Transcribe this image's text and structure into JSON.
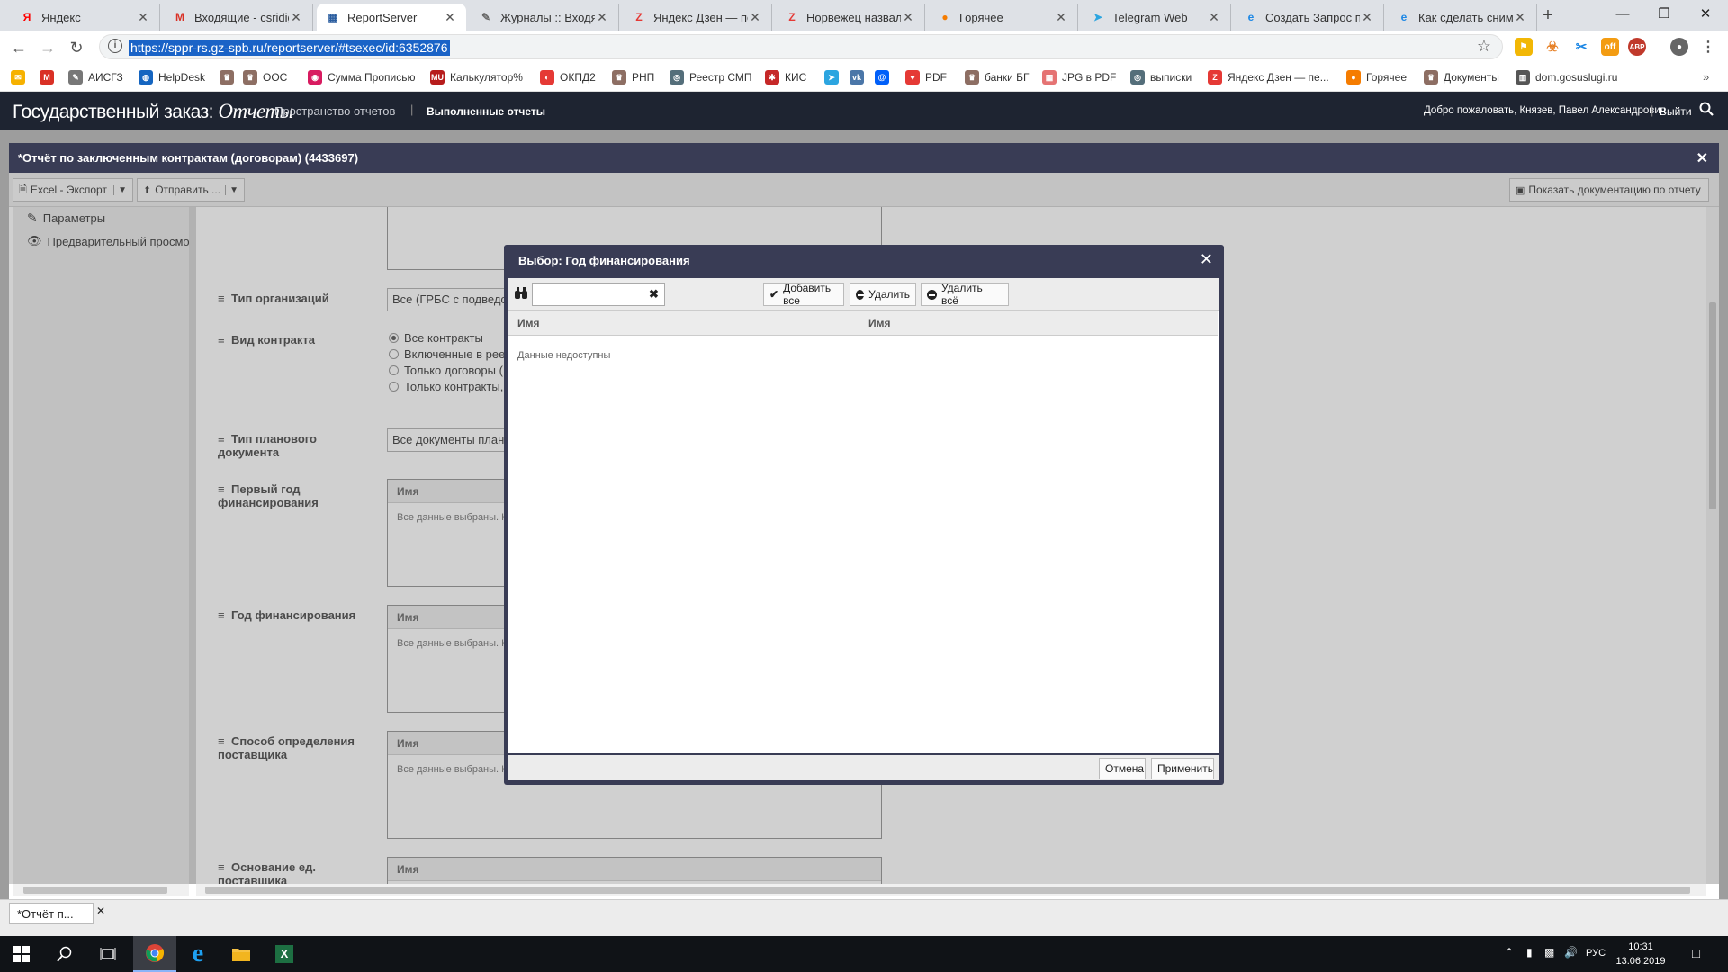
{
  "browser": {
    "tabs": [
      {
        "title": "Яндекс",
        "icon": "yandex-icon",
        "color": "#ff0000",
        "glyph": "Я"
      },
      {
        "title": "Входящие - csridigi",
        "icon": "gmail-icon",
        "color": "#d93025",
        "glyph": "M"
      },
      {
        "title": "ReportServer",
        "icon": "reportserver-icon",
        "color": "#2a5d9f",
        "glyph": "▦"
      },
      {
        "title": "Журналы :: Входящ",
        "icon": "tools-icon",
        "color": "#666",
        "glyph": "✎"
      },
      {
        "title": "Яндекс Дзен — пе",
        "icon": "zen-icon",
        "color": "#e53935",
        "glyph": "Z"
      },
      {
        "title": "Норвежец назвал",
        "icon": "zen-icon",
        "color": "#e53935",
        "glyph": "Z"
      },
      {
        "title": "Горячее",
        "icon": "pikabu-icon",
        "color": "#f57c00",
        "glyph": "●"
      },
      {
        "title": "Telegram Web",
        "icon": "telegram-icon",
        "color": "#2ca5e0",
        "glyph": "➤"
      },
      {
        "title": "Создать Запрос по",
        "icon": "edge-icon",
        "color": "#1e88e5",
        "glyph": "e"
      },
      {
        "title": "Как сделать снимо",
        "icon": "edge-icon",
        "color": "#1e88e5",
        "glyph": "e"
      }
    ],
    "url": "https://sppr-rs.gz-spb.ru/reportserver/#tsexec/id:6352876",
    "bookmarks": [
      {
        "label": "",
        "icon": "mail-icon",
        "color": "#f6b100",
        "glyph": "✉"
      },
      {
        "label": "",
        "icon": "gmail-icon",
        "color": "#d93025",
        "glyph": "M"
      },
      {
        "label": "АИСГЗ",
        "icon": "tools-icon",
        "color": "#777",
        "glyph": "✎"
      },
      {
        "label": "HelpDesk",
        "icon": "globe-icon",
        "color": "#1565c0",
        "glyph": "◍"
      },
      {
        "label": "",
        "icon": "emblem-icon",
        "color": "#8d6e63",
        "glyph": "♛"
      },
      {
        "label": "ООС",
        "icon": "emblem-icon",
        "color": "#8d6e63",
        "glyph": "♛"
      },
      {
        "label": "Сумма Прописью",
        "icon": "sum-icon",
        "color": "#d81b60",
        "glyph": "◉"
      },
      {
        "label": "Калькулятор%",
        "icon": "calc-icon",
        "color": "#b71c1c",
        "glyph": "MU"
      },
      {
        "label": "ОКПД2",
        "icon": "okpd-icon",
        "color": "#e53935",
        "glyph": "◐"
      },
      {
        "label": "РНП",
        "icon": "emblem-icon",
        "color": "#8d6e63",
        "glyph": "♛"
      },
      {
        "label": "Реестр СМП",
        "icon": "registry-icon",
        "color": "#546e7a",
        "glyph": "◎"
      },
      {
        "label": "КИС",
        "icon": "kis-icon",
        "color": "#c62828",
        "glyph": "✱"
      },
      {
        "label": "",
        "icon": "telegram-icon",
        "color": "#2ca5e0",
        "glyph": "➤"
      },
      {
        "label": "",
        "icon": "vk-icon",
        "color": "#4a76a8",
        "glyph": "vk"
      },
      {
        "label": "",
        "icon": "mail-ru-icon",
        "color": "#005ff9",
        "glyph": "@"
      },
      {
        "label": "PDF",
        "icon": "pdf-icon",
        "color": "#e53935",
        "glyph": "♥"
      },
      {
        "label": "банки БГ",
        "icon": "emblem-icon",
        "color": "#8d6e63",
        "glyph": "♛"
      },
      {
        "label": "JPG в PDF",
        "icon": "jpg-icon",
        "color": "#e57373",
        "glyph": "▦"
      },
      {
        "label": "выписки",
        "icon": "registry-icon",
        "color": "#546e7a",
        "glyph": "◎"
      },
      {
        "label": "Яндекс Дзен — пе...",
        "icon": "zen-icon",
        "color": "#e53935",
        "glyph": "Z"
      },
      {
        "label": "Горячее",
        "icon": "pikabu-icon",
        "color": "#f57c00",
        "glyph": "●"
      },
      {
        "label": "Документы",
        "icon": "emblem-icon",
        "color": "#8d6e63",
        "glyph": "♛"
      },
      {
        "label": "dom.gosuslugi.ru",
        "icon": "building-icon",
        "color": "#555",
        "glyph": "▥"
      }
    ]
  },
  "app": {
    "brand": "Государственный заказ:",
    "brand_script": "Отчеты",
    "nav_spaces": "Пространство отчетов",
    "nav_done": "Выполненные отчеты",
    "welcome": "Добро пожаловать, Князев, Павел Александрович",
    "logout": "Выйти"
  },
  "report": {
    "title": "*Отчёт по заключенным контрактам (договорам) (4433697)",
    "excel_btn": "Excel - Экспорт",
    "send_btn": "Отправить ...",
    "docs_btn": "Показать документацию по отчету",
    "side_params": "Параметры",
    "side_preview": "Предварительный просмо",
    "params": {
      "org_type_label": "Тип организаций",
      "org_type_value": "Все (ГРБС с подведом",
      "contract_kind_label": "Вид контракта",
      "contract_kind_options": [
        "Все контракты",
        "Включенные в реес",
        "Только договоры (",
        "Только контракты,"
      ],
      "plan_doc_label": "Тип планового документа",
      "plan_doc_value": "Все документы план",
      "first_year_label": "Первый год финансирования",
      "year_label": "Год финансирования",
      "supplier_label": "Способ определения поставщика",
      "basis_label": "Основание ед. поставщика",
      "col_name": "Имя",
      "all_selected": "Все данные выбраны. Н"
    },
    "bottom_tab": "*Отчёт п..."
  },
  "dialog": {
    "title": "Выбор: Год финансирования",
    "search_value": "",
    "add_all": "Добавить все",
    "remove": "Удалить",
    "remove_all": "Удалить всё",
    "col_left": "Имя",
    "col_right": "Имя",
    "empty_text": "Данные недоступны",
    "cancel": "Отмена",
    "apply": "Применить"
  },
  "taskbar": {
    "lang": "РУС",
    "time": "10:31",
    "date": "13.06.2019"
  }
}
